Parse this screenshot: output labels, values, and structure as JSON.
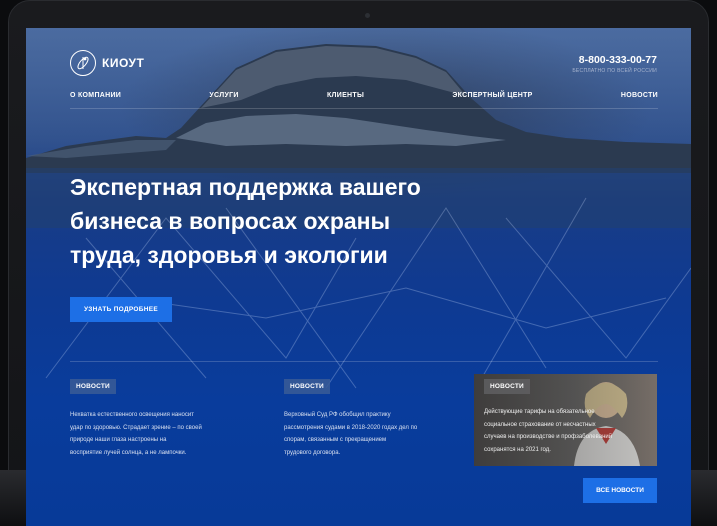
{
  "logo": {
    "text": "КИОУТ"
  },
  "contact": {
    "phone": "8-800-333-00-77",
    "note": "БЕСПЛАТНО ПО ВСЕЙ РОССИИ"
  },
  "nav": {
    "items": [
      {
        "label": "О КОМПАНИИ"
      },
      {
        "label": "УСЛУГИ"
      },
      {
        "label": "КЛИЕНТЫ"
      },
      {
        "label": "ЭКСПЕРТНЫЙ ЦЕНТР"
      },
      {
        "label": "НОВОСТИ"
      }
    ]
  },
  "hero": {
    "title": "Экспертная поддержка вашего\nбизнеса в вопросах охраны\nтруда, здоровья и экологии",
    "cta_label": "УЗНАТЬ ПОДРОБНЕЕ"
  },
  "news": {
    "items": [
      {
        "badge": "НОВОСТИ",
        "text": "Нехватка естественного освещения наносит\nудар по здоровью. Страдает зрение – по своей\nприроде наши глаза настроены на\nвосприятие лучей солнца, а не лампочки."
      },
      {
        "badge": "НОВОСТИ",
        "text": "Верховный Суд РФ обобщил практику\nрассмотрения судами в 2018-2020 годах дел по\nспорам, связанным с прекращением\nтрудового договора."
      },
      {
        "badge": "НОВОСТИ",
        "text": "Действующие тарифы на обязательное\nсоциальное страхование от несчастных\nслучаев на производстве и профзаболеваний\nсохранятся на 2021 год."
      }
    ],
    "all_label": "ВСЕ НОВОСТИ"
  },
  "colors": {
    "accent": "#1d6fe6",
    "background": "#0a3c9a",
    "badge": "#3a5c96"
  },
  "icons": {
    "logo": "atom-logo-icon"
  }
}
